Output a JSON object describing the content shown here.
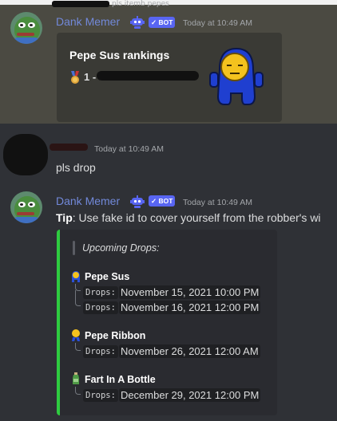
{
  "reply_preview": "pls itemb pepes",
  "messages": [
    {
      "author": "Dank Memer",
      "badge": "✓ BOT",
      "time": "Today at 10:49 AM",
      "embed": {
        "title": "Pepe Sus rankings",
        "line": "1 - 5"
      }
    },
    {
      "author": "",
      "time": "Today at 10:49 AM",
      "text": "pls drop"
    },
    {
      "author": "Dank Memer",
      "badge": "✓ BOT",
      "time": "Today at 10:49 AM",
      "tip_label": "Tip",
      "tip_text": ": Use fake id to cover yourself from the robber's wi",
      "embed": {
        "accent_color": "#2ecc40",
        "quote": "Upcoming Drops:",
        "drops": [
          {
            "name": "Pepe Sus",
            "icon": "pepe-sus-icon",
            "rows": [
              {
                "code": "Drops:",
                "date": "November 15, 2021 10:00 PM"
              },
              {
                "code": "Drops:",
                "date": "November 16, 2021 12:00 PM"
              }
            ]
          },
          {
            "name": "Pepe Ribbon",
            "icon": "pepe-ribbon-icon",
            "rows": [
              {
                "code": "Drops:",
                "date": "November 26, 2021 12:00 AM"
              }
            ]
          },
          {
            "name": "Fart In A Bottle",
            "icon": "bottle-icon",
            "rows": [
              {
                "code": "Drops:",
                "date": "December 29, 2021 12:00 PM"
              }
            ]
          }
        ]
      }
    }
  ]
}
